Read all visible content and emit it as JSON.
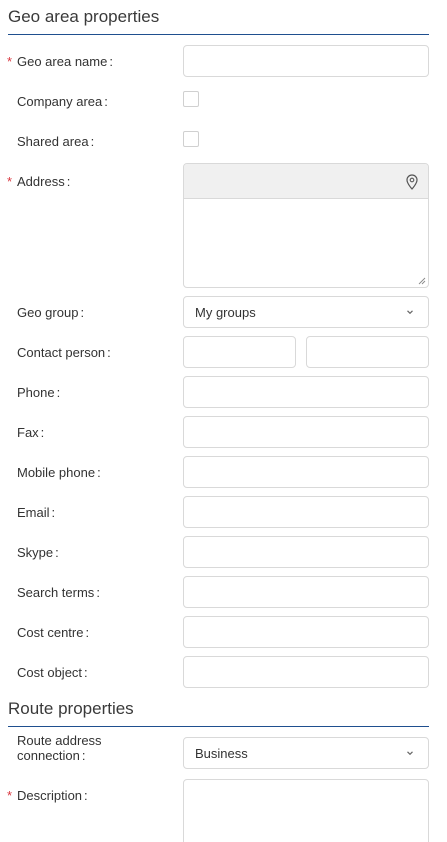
{
  "geo_section": {
    "title": "Geo area properties"
  },
  "fields": {
    "geo_area_name": {
      "label": "Geo area name",
      "required": "*",
      "value": ""
    },
    "company_area": {
      "label": "Company area"
    },
    "shared_area": {
      "label": "Shared area"
    },
    "address": {
      "label": "Address",
      "required": "*",
      "value": ""
    },
    "geo_group": {
      "label": "Geo group",
      "value": "My groups"
    },
    "contact_person": {
      "label": "Contact person",
      "first": "",
      "last": ""
    },
    "phone": {
      "label": "Phone",
      "value": ""
    },
    "fax": {
      "label": "Fax",
      "value": ""
    },
    "mobile_phone": {
      "label": "Mobile phone",
      "value": ""
    },
    "email": {
      "label": "Email",
      "value": ""
    },
    "skype": {
      "label": "Skype",
      "value": ""
    },
    "search_terms": {
      "label": "Search terms",
      "value": ""
    },
    "cost_centre": {
      "label": "Cost centre",
      "value": ""
    },
    "cost_object": {
      "label": "Cost object",
      "value": ""
    }
  },
  "route_section": {
    "title": "Route properties"
  },
  "route_fields": {
    "route_address_connection": {
      "label_line1": "Route address",
      "label_line2": "connection",
      "value": "Business"
    },
    "description": {
      "label": "Description",
      "required": "*",
      "value": ""
    }
  },
  "colon": ":",
  "icons": {
    "address": "map-pin-icon",
    "select": "chevron-down-icon"
  },
  "colors": {
    "accent_line": "#1f4f8f",
    "required": "#d9363e"
  }
}
